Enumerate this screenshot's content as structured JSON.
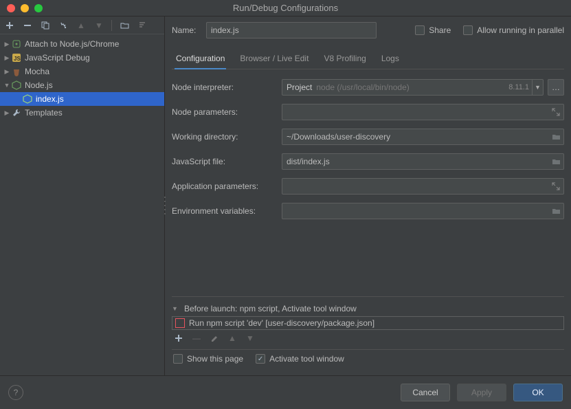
{
  "window": {
    "title": "Run/Debug Configurations"
  },
  "sidebar": {
    "items": [
      {
        "label": "Attach to Node.js/Chrome",
        "icon": "node-attach-icon",
        "collapsed": true
      },
      {
        "label": "JavaScript Debug",
        "icon": "js-debug-icon",
        "collapsed": true
      },
      {
        "label": "Mocha",
        "icon": "mocha-icon",
        "collapsed": true
      },
      {
        "label": "Node.js",
        "icon": "node-icon",
        "collapsed": false,
        "children": [
          {
            "label": "index.js",
            "selected": true
          }
        ]
      },
      {
        "label": "Templates",
        "icon": "wrench-icon",
        "collapsed": true
      }
    ]
  },
  "main": {
    "name_label": "Name:",
    "name_value": "index.js",
    "share_label": "Share",
    "parallel_label": "Allow running in parallel",
    "tabs": [
      "Configuration",
      "Browser / Live Edit",
      "V8 Profiling",
      "Logs"
    ],
    "active_tab": 0,
    "fields": {
      "node_interpreter": {
        "label": "Node interpreter:",
        "prefix": "Project",
        "path": "node (/usr/local/bin/node)",
        "version": "8.11.1"
      },
      "node_parameters": {
        "label": "Node parameters:",
        "value": ""
      },
      "working_directory": {
        "label": "Working directory:",
        "value": "~/Downloads/user-discovery"
      },
      "javascript_file": {
        "label": "JavaScript file:",
        "value": "dist/index.js"
      },
      "application_parameters": {
        "label": "Application parameters:",
        "value": ""
      },
      "environment_variables": {
        "label": "Environment variables:",
        "value": ""
      }
    },
    "before_launch": {
      "header": "Before launch: npm script, Activate tool window",
      "item": "Run npm script 'dev' [user-discovery/package.json]",
      "show_page_label": "Show this page",
      "activate_label": "Activate tool window",
      "show_page_checked": false,
      "activate_checked": true
    }
  },
  "footer": {
    "cancel": "Cancel",
    "apply": "Apply",
    "ok": "OK"
  }
}
